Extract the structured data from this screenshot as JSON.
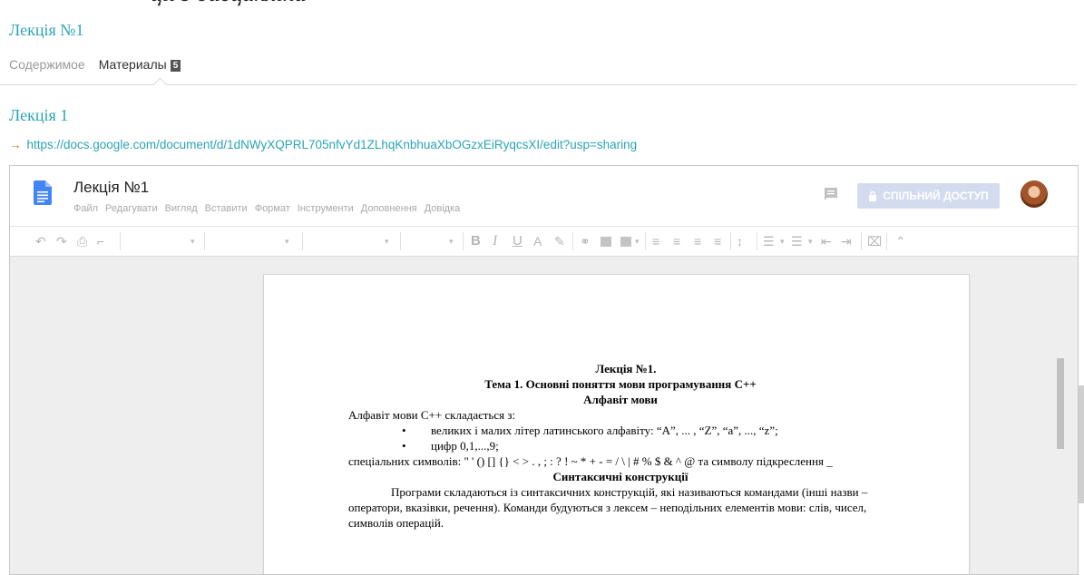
{
  "top_clipped_text": "ції з дисципліни",
  "course": {
    "title": "Лекція №1"
  },
  "tabs": [
    {
      "label": "Содержимое",
      "active": false
    },
    {
      "label": "Материалы",
      "active": true,
      "badge": "5"
    }
  ],
  "material": {
    "title": "Лекція 1",
    "link": "https://docs.google.com/document/d/1dNWyXQPRL705nfvYd1ZLhqKnbhuaXbOGzxEiRyqcsXI/edit?usp=sharing"
  },
  "gdoc": {
    "title": "Лекція №1",
    "menu": [
      "Файл",
      "Редагувати",
      "Вигляд",
      "Вставити",
      "Формат",
      "Інструменти",
      "Доповнення",
      "Довідка"
    ],
    "share_label": "СПІЛЬНИЙ ДОСТУП",
    "accent_color": "#4285f4",
    "share_color": "#d3dcee"
  },
  "document": {
    "heading_1": "Лекція №1.",
    "heading_2": "Тема 1. Основні поняття мови програмування С++",
    "heading_3": "Алфавіт мови",
    "intro": "Алфавіт мови С++ складається з:",
    "bullets": [
      "великих і малих літер латинського алфавіту: “A”, ... , “Z”, “a”, ..., “z”;",
      "цифр 0,1,...,9;"
    ],
    "special": "спеціальних символів: \" ' () [] {} < > . , ; : ? ! ~ * + - = / \\ | # % $ & ^ @ та символу підкреслення _",
    "heading_4": "Синтаксичні конструкції",
    "para_1": "Програми складаються із синтаксичних конструкцій, які називаються командами (інші назви – оператори, вказівки, речення).  Команди будуються з лексем – неподільних елементів мови: слів, чисел, символів операцій."
  }
}
